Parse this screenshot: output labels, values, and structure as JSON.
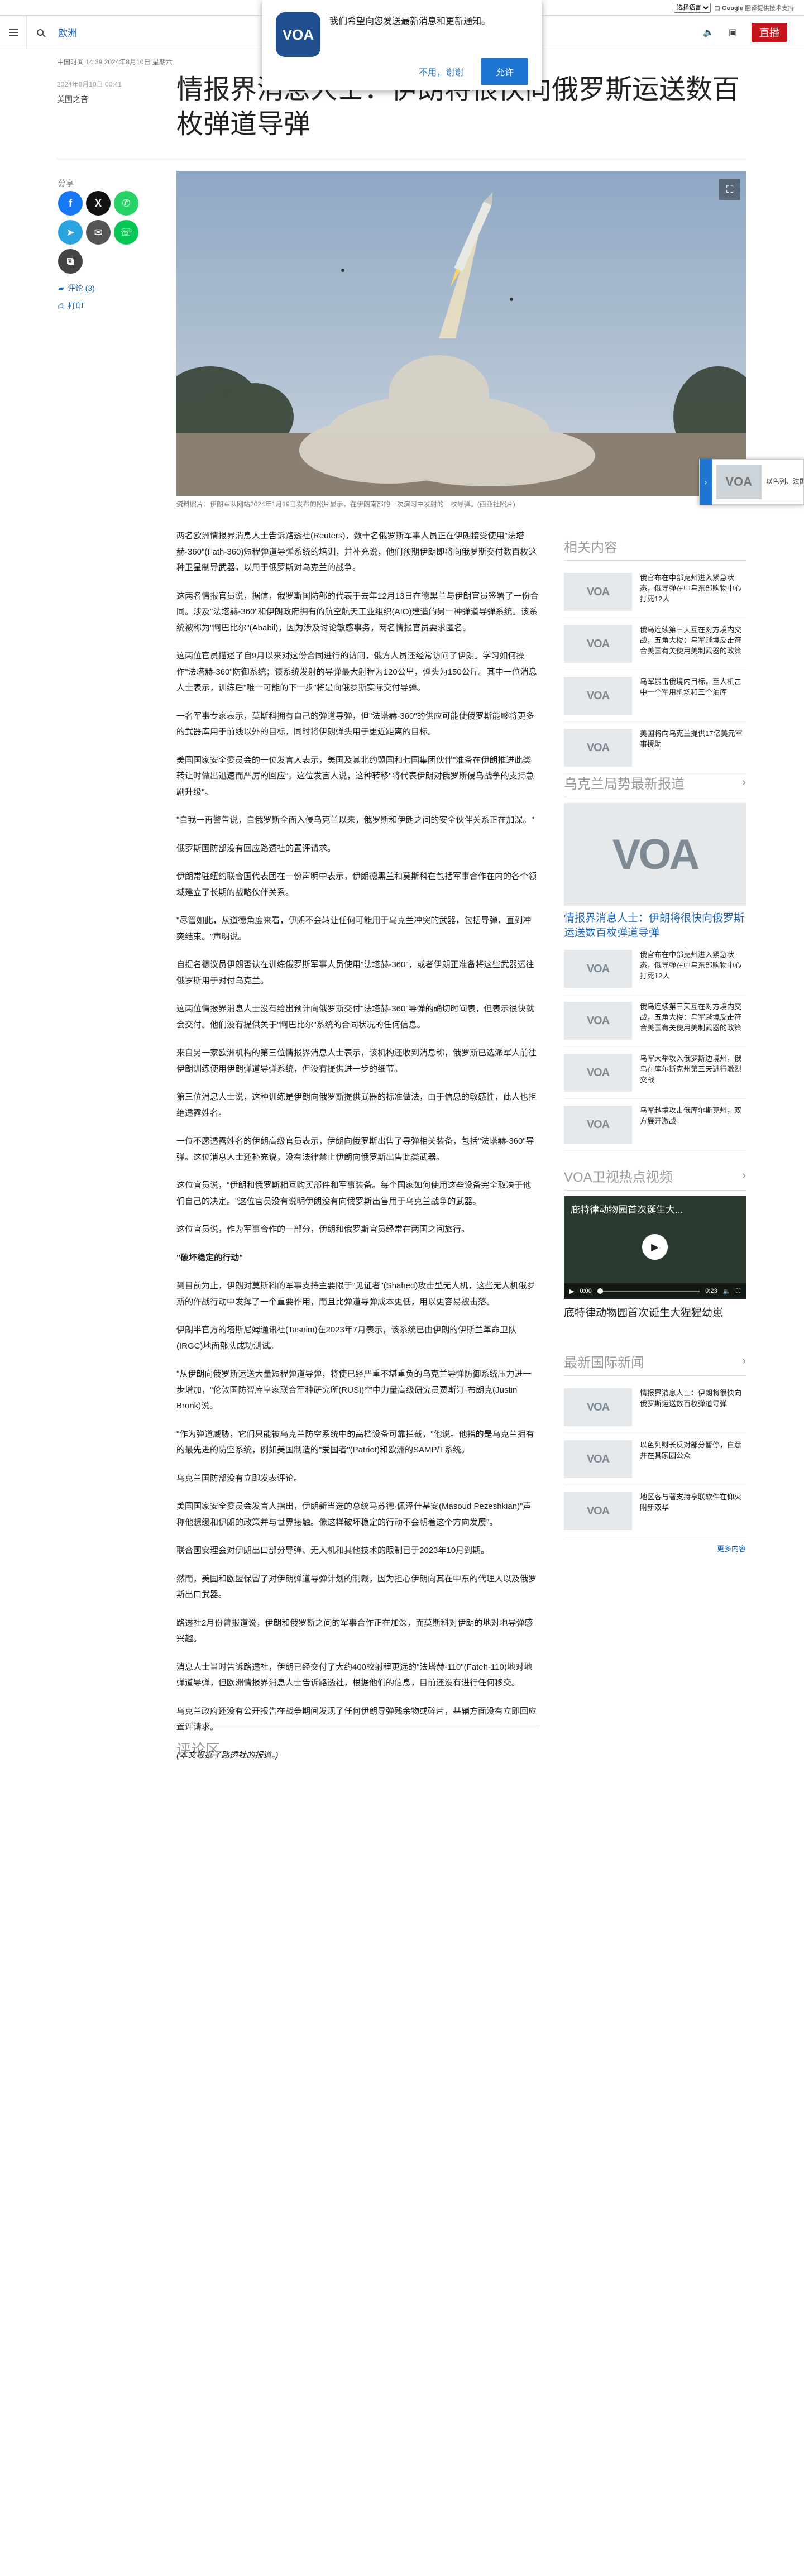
{
  "translate": {
    "selector": "选择语言",
    "powered_prefix": "由",
    "powered_brand": "Google",
    "powered_suffix": "翻译提供技术支持"
  },
  "header": {
    "section": "欧洲",
    "live_label": "直播"
  },
  "notification": {
    "logo": "VOA",
    "message": "我们希望向您发送最新消息和更新通知。",
    "decline": "不用，谢谢",
    "accept": "允许"
  },
  "article": {
    "timestamp": "中国时间 14:39 2024年8月10日 星期六",
    "date": "2024年8月10日 00:41",
    "byline": "美国之音",
    "headline": "情报界消息人士：伊朗将很快向俄罗斯运送数百枚弹道导弹",
    "caption": "资料照片：伊朗军队网站2024年1月19日发布的照片显示，在伊朗南部的一次演习中发射的一枚导弹。(西亚社照片)",
    "paragraphs": [
      "两名欧洲情报界消息人士告诉路透社(Reuters)，数十名俄罗斯军事人员正在伊朗接受使用\"法塔赫-360\"(Fath-360)短程弹道导弹系统的培训，并补充说，他们预期伊朗即将向俄罗斯交付数百枚这种卫星制导武器，以用于俄罗斯对乌克兰的战争。",
      "这两名情报官员说，据信，俄罗斯国防部的代表于去年12月13日在德黑兰与伊朗官员签署了一份合同。涉及\"法塔赫-360\"和伊朗政府拥有的航空航天工业组织(AIO)建造的另一种弹道导弹系统。该系统被称为\"阿巴比尔\"(Ababil)，因为涉及讨论敏感事务，两名情报官员要求匿名。",
      "这两位官员描述了自9月以来对这份合同进行的访问，俄方人员还经常访问了伊朗。学习如何操作\"法塔赫-360\"防御系统；该系统发射的导弹最大射程为120公里，弹头为150公斤。其中一位消息人士表示，训练后\"唯一可能的下一步\"将是向俄罗斯实际交付导弹。",
      "一名军事专家表示，莫斯科拥有自己的弹道导弹，但\"法塔赫-360\"的供应可能使俄罗斯能够将更多的武器库用于前线以外的目标，同时将伊朗弹头用于更近距离的目标。",
      "美国国家安全委员会的一位发言人表示，美国及其北约盟国和七国集团伙伴\"准备在伊朗推进此类转让时做出迅速而严厉的回应\"。这位发言人说，这种转移\"将代表伊朗对俄罗斯侵乌战争的支持急剧升级\"。",
      "\"自我一再警告说，自俄罗斯全面入侵乌克兰以来，俄罗斯和伊朗之间的安全伙伴关系正在加深。\"",
      "俄罗斯国防部没有回应路透社的置评请求。",
      "伊朗常驻纽约联合国代表团在一份声明中表示，伊朗德黑兰和莫斯科在包括军事合作在内的各个领域建立了长期的战略伙伴关系。",
      "\"尽管如此，从道德角度来看，伊朗不会转让任何可能用于乌克兰冲突的武器，包括导弹，直到冲突结束。\"声明说。",
      "自提名德议员伊朗否认在训练俄罗斯军事人员使用\"法塔赫-360\"，或者伊朗正准备将这些武器运往俄罗斯用于对付乌克兰。",
      "这两位情报界消息人士没有给出预计向俄罗斯交付\"法塔赫-360\"导弹的确切时间表，但表示很快就会交付。他们没有提供关于\"阿巴比尔\"系统的合同状况的任何信息。",
      "来自另一家欧洲机构的第三位情报界消息人士表示，该机构还收到消息称，俄罗斯已选派军人前往伊朗训练使用伊朗弹道导弹系统，但没有提供进一步的细节。",
      "第三位消息人士说，这种训练是伊朗向俄罗斯提供武器的标准做法，由于信息的敏感性，此人也拒绝透露姓名。",
      "一位不愿透露姓名的伊朗高级官员表示，伊朗向俄罗斯出售了导弹相关装备，包括\"法塔赫-360\"导弹。这位消息人士还补充说，没有法律禁止伊朗向俄罗斯出售此类武器。",
      "这位官员说，\"伊朗和俄罗斯相互购买部件和军事装备。每个国家如何使用这些设备完全取决于他们自己的决定。\"这位官员没有说明伊朗没有向俄罗斯出售用于乌克兰战争的武器。",
      "这位官员说，作为军事合作的一部分，伊朗和俄罗斯官员经常在两国之间旅行。"
    ],
    "subheading": "\"破坏稳定的行动\"",
    "paragraphs2": [
      "到目前为止，伊朗对莫斯科的军事支持主要限于\"见证者\"(Shahed)攻击型无人机，这些无人机俄罗斯的作战行动中发挥了一个重要作用，而且比弹道导弹成本更低，用以更容易被击落。",
      "伊朗半官方的塔斯尼姆通讯社(Tasnim)在2023年7月表示，该系统已由伊朗的伊斯兰革命卫队(IRGC)地面部队成功测试。",
      "\"从伊朗向俄罗斯运送大量短程弹道导弹，将使已经严重不堪重负的乌克兰导弹防御系统压力进一步增加，\"伦敦国防智库皇家联合军种研究所(RUSI)空中力量高级研究员贾斯汀·布朗克(Justin Bronk)说。",
      "\"作为弹道威胁，它们只能被乌克兰防空系统中的高档设备可靠拦截，\"他说。他指的是乌克兰拥有的最先进的防空系统，例如美国制造的\"爱国者\"(Patriot)和欧洲的SAMP/T系统。",
      "乌克兰国防部没有立即发表评论。",
      "美国国家安全委员会发言人指出，伊朗新当选的总统马苏德·佩泽什基安(Masoud Pezeshkian)\"声称他想缓和伊朗的政策并与世界接触。像这样破坏稳定的行动不会朝着这个方向发展\"。",
      "联合国安理会对伊朗出口部分导弹、无人机和其他技术的限制已于2023年10月到期。",
      "然而，美国和欧盟保留了对伊朗弹道导弹计划的制裁，因为担心伊朗向其在中东的代理人以及俄罗斯出口武器。",
      "路透社2月份曾报道说，伊朗和俄罗斯之间的军事合作正在加深，而莫斯科对伊朗的地对地导弹感兴趣。",
      "消息人士当时告诉路透社，伊朗已经交付了大约400枚射程更远的\"法塔赫-110\"(Fateh-110)地对地弹道导弹，但欧洲情报界消息人士告诉路透社，根据他们的信息，目前还没有进行任何移交。",
      "乌克兰政府还没有公开报告在战争期间发现了任何伊朗导弹残余物或碎片，基辅方面没有立即回应置评请求。"
    ],
    "note": "(本文根据了路透社的报道。)",
    "comments_heading": "评论区"
  },
  "share": {
    "label": "分享",
    "comments": "评论 (3)",
    "print": "打印"
  },
  "mini_player": {
    "logo": "VOA",
    "text": "以色列、法国、日本"
  },
  "sidebar": {
    "related": {
      "title": "相关内容",
      "items": [
        "俄官布在中部克州进入紧急状态，俄导弹在中乌东部购物中心打死12人",
        "俄乌连续第三天互在对方境内交战，五角大楼：乌军越境反击符合美国有关使用美制武器的政策",
        "乌军暴击俄境内目标，至人机击中一个军用机场和三个油库",
        "美国将向乌克兰提供17亿美元军事援助"
      ]
    },
    "ukraine": {
      "title": "乌克兰局势最新报道",
      "lead": "情报界消息人士：伊朗将很快向俄罗斯运送数百枚弹道导弹",
      "items": [
        "俄官布在中部克州进入紧急状态，俄导弹在中乌东部购物中心打死12人",
        "俄乌连续第三天互在对方境内交战，五角大楼：乌军越境反击符合美国有关使用美制武器的政策",
        "乌军大举攻入俄罗斯边境州，俄乌在库尔斯克州第三天进行激烈交战",
        "乌军越境攻击俄库尔斯克州，双方展开激战"
      ]
    },
    "video": {
      "title": "VOA卫视热点视频",
      "overlay": "庇特律动物园首次诞生大...",
      "time_current": "0:00",
      "time_total": "0:23",
      "caption": "底特律动物园首次诞生大猩猩幼崽"
    },
    "world": {
      "title": "最新国际新闻",
      "items": [
        "情报界消息人士：伊朗将很快向俄罗斯运送数百枚弹道导弹",
        "以色列财长反对部分暂停，自意并在其家园公众",
        "地区客与著支持亨联软件在仰火附新双华"
      ],
      "more": "更多内容"
    }
  },
  "colors": {
    "accent": "#1e64b4",
    "live": "#c4161c",
    "allow": "#1e76d2"
  },
  "icons": [
    "menu-icon",
    "search-icon",
    "speaker-icon",
    "tv-icon",
    "facebook-icon",
    "x-icon",
    "whatsapp-icon",
    "telegram-icon",
    "email-icon",
    "line-icon",
    "copy-link-icon",
    "comment-icon",
    "print-icon",
    "expand-icon",
    "chevron-right-icon",
    "play-icon"
  ]
}
